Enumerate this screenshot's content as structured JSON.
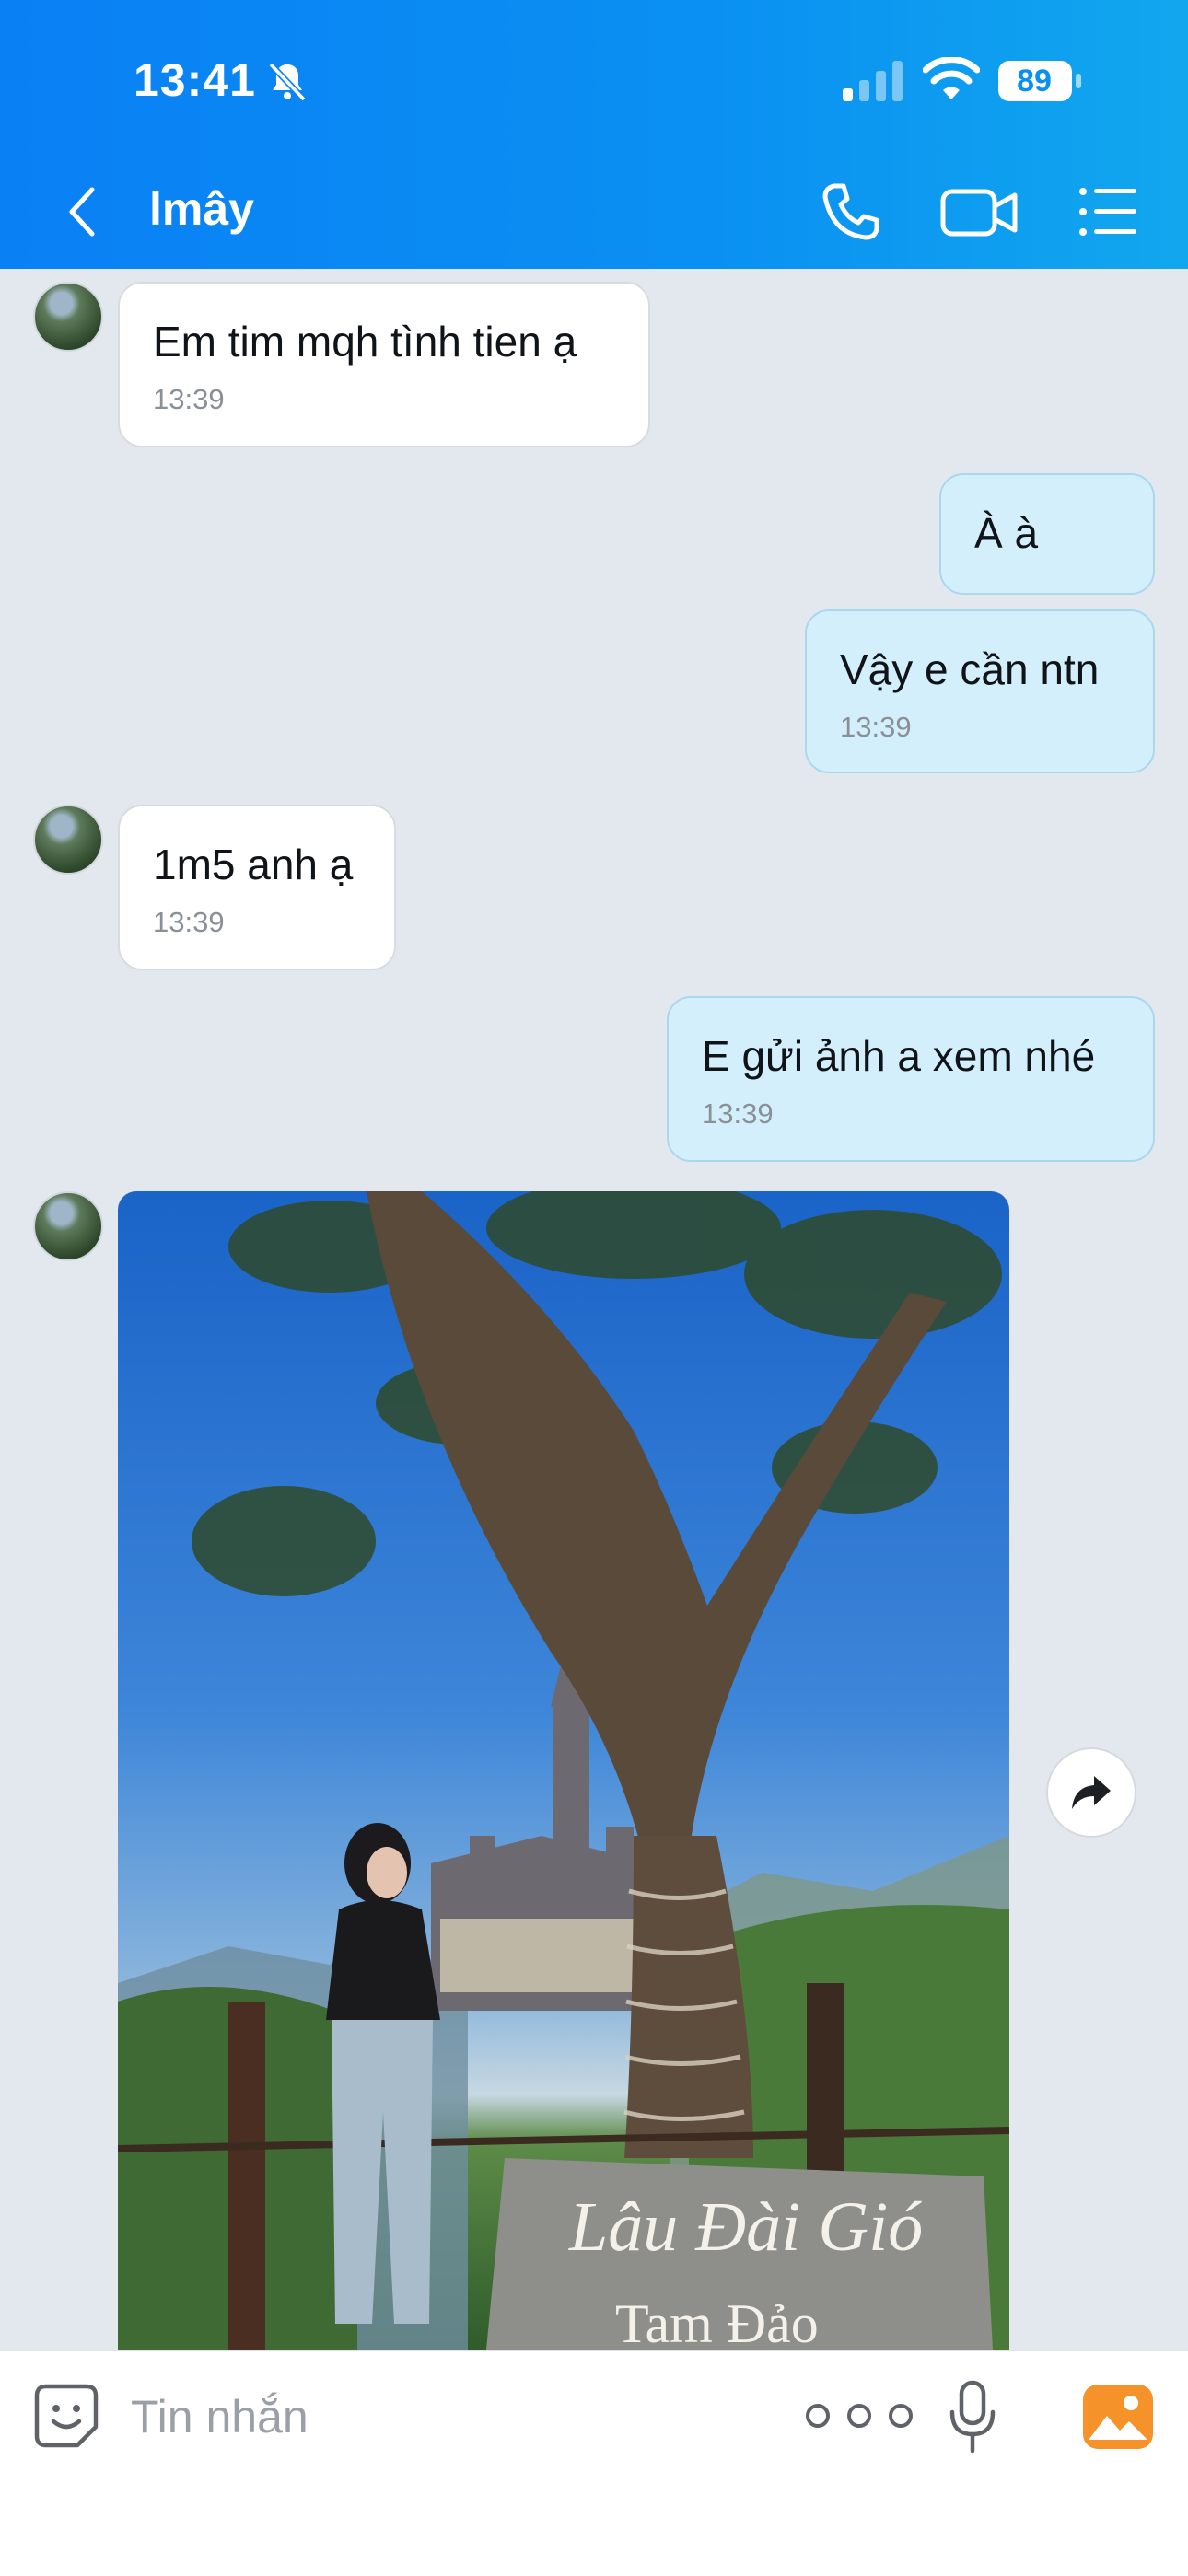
{
  "status_bar": {
    "time": "13:41",
    "battery": "89"
  },
  "header": {
    "title": "lmây"
  },
  "messages": [
    {
      "sender": "contact",
      "text": "Em tim mqh tình tien ạ",
      "time": "13:39"
    },
    {
      "sender": "me",
      "text": "À à"
    },
    {
      "sender": "me",
      "text": "Vậy e cần ntn",
      "time": "13:39"
    },
    {
      "sender": "contact",
      "text": "1m5 anh ạ",
      "time": "13:39"
    },
    {
      "sender": "me",
      "text": "E gửi ảnh a xem nhé",
      "time": "13:39"
    },
    {
      "sender": "contact",
      "type": "photo",
      "sign_text_line1": "Lâu Đài Gió",
      "sign_text_line2": "Tam Đảo"
    }
  ],
  "input": {
    "placeholder": "Tin nhắn"
  },
  "icons": {
    "back": "chevron-left-icon",
    "call": "phone-icon",
    "video": "video-camera-icon",
    "menu": "list-icon",
    "forward": "share-arrow-icon",
    "emoji": "sticker-icon",
    "more": "more-dots-icon",
    "mic": "microphone-icon",
    "gallery": "gallery-icon"
  },
  "colors": {
    "header": "#0a8ff2",
    "outgoing_bubble": "#d4effc",
    "incoming_bubble": "#ffffff",
    "background": "#e3e8ef",
    "gallery_icon": "#f5932a"
  }
}
